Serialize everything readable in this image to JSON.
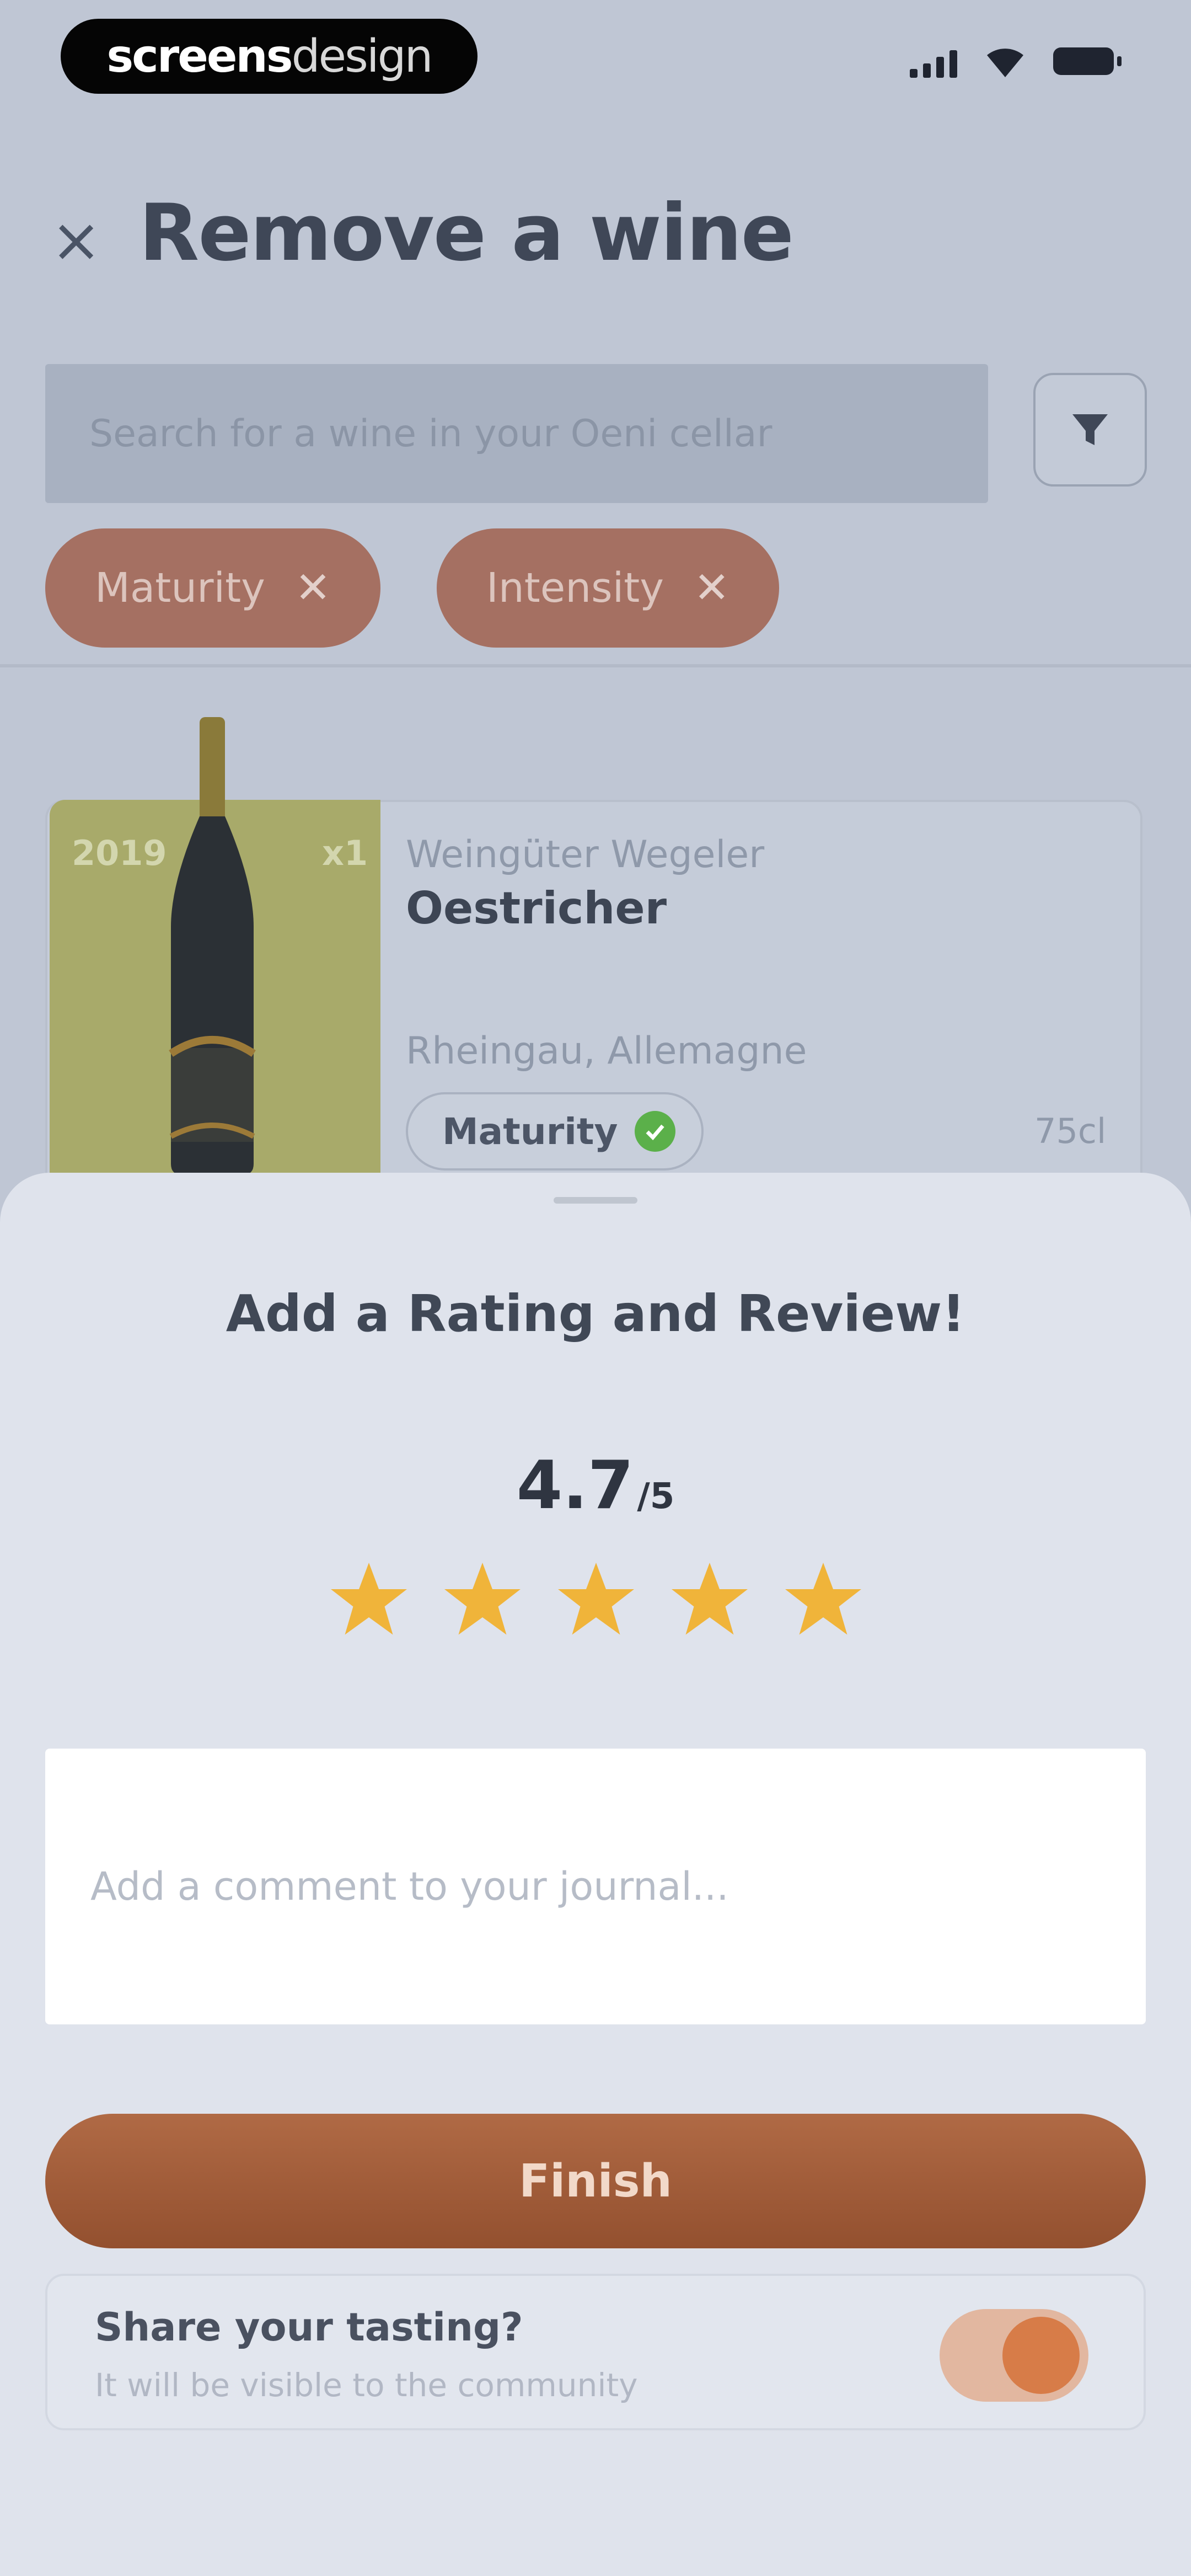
{
  "brand": {
    "bold": "screens",
    "thin": "design"
  },
  "header": {
    "title": "Remove a wine"
  },
  "search": {
    "placeholder": "Search for a wine in your Oeni cellar"
  },
  "filters": [
    {
      "label": "Maturity"
    },
    {
      "label": "Intensity"
    }
  ],
  "wine": {
    "year": "2019",
    "quantity": "x1",
    "producer": "Weingüter Wegeler",
    "name": "Oestricher",
    "region": "Rheingau, Allemagne",
    "maturity_label": "Maturity",
    "volume": "75cl"
  },
  "sheet": {
    "title": "Add a Rating and Review!",
    "rating_value": "4.7",
    "rating_max": "/5",
    "stars": 5,
    "comment_placeholder": "Add a comment to your journal...",
    "finish_label": "Finish",
    "share_title": "Share your tasting?",
    "share_subtitle": "It will be visible to the community",
    "share_enabled": true
  },
  "colors": {
    "accent": "#a0582f",
    "star": "#f0b43a",
    "chip": "#a57062"
  }
}
